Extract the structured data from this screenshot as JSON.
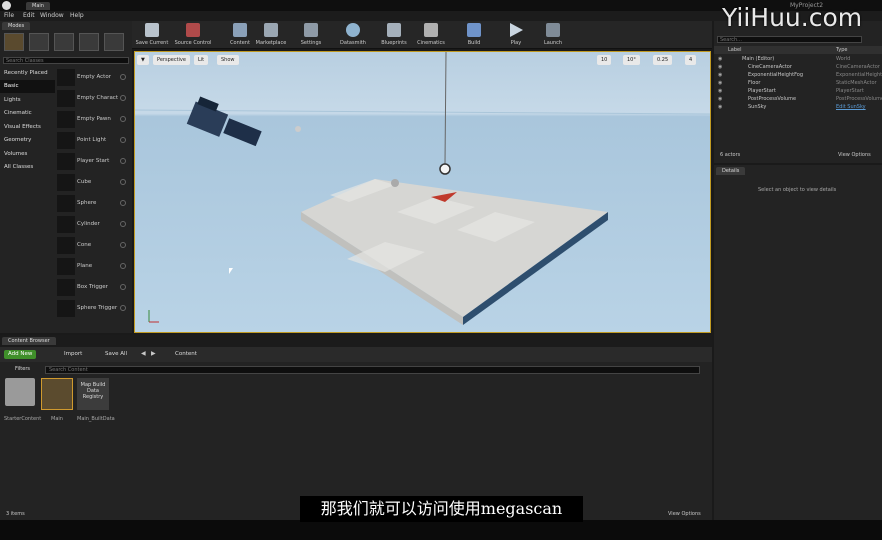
{
  "window": {
    "tab": "Main",
    "project": "MyProject2"
  },
  "menu": [
    "File",
    "Edit",
    "Window",
    "Help"
  ],
  "modes": {
    "title": "Modes",
    "search_placeholder": "Search Classes",
    "categories": [
      "Recently Placed",
      "Basic",
      "Lights",
      "Cinematic",
      "Visual Effects",
      "Geometry",
      "Volumes",
      "All Classes"
    ],
    "items": [
      "Empty Actor",
      "Empty Charact",
      "Empty Pawn",
      "Point Light",
      "Player Start",
      "Cube",
      "Sphere",
      "Cylinder",
      "Cone",
      "Plane",
      "Box Trigger",
      "Sphere Trigger"
    ]
  },
  "toolbar": [
    "Save Current",
    "Source Control",
    "Content",
    "Marketplace",
    "Settings",
    "Datasmith",
    "Blueprints",
    "Cinematics",
    "Build",
    "Play",
    "Launch"
  ],
  "viewport": {
    "view_mode": "Perspective",
    "lighting": "Lit",
    "show": "Show",
    "grid_snap": "10",
    "rot_snap": "10°",
    "scale_snap": "0.25",
    "camera_speed": "4"
  },
  "outliner": {
    "search_placeholder": "Search...",
    "col_label": "Label",
    "col_type": "Type",
    "rows": [
      {
        "label": "Main (Editor)",
        "type": "World"
      },
      {
        "label": "CineCameraActor",
        "type": "CineCameraActor"
      },
      {
        "label": "ExponentialHeightFog",
        "type": "ExponentialHeightFog"
      },
      {
        "label": "Floor",
        "type": "StaticMeshActor"
      },
      {
        "label": "PlayerStart",
        "type": "PlayerStart"
      },
      {
        "label": "PostProcessVolume",
        "type": "PostProcessVolume"
      },
      {
        "label": "SunSky",
        "type": "Edit SunSky"
      }
    ],
    "count": "6 actors",
    "view_options": "View Options"
  },
  "details": {
    "title": "Details",
    "empty_text": "Select an object to view details"
  },
  "content_browser": {
    "tab": "Content Browser",
    "add_new": "Add New",
    "import": "Import",
    "save_all": "Save All",
    "path": "Content",
    "filters": "Filters",
    "search_placeholder": "Search Content",
    "assets": [
      {
        "name": "StarterContent",
        "thumb": ""
      },
      {
        "name": "Main",
        "thumb": ""
      },
      {
        "name": "Main_BuiltData",
        "thumb": "Map Build Data Registry"
      }
    ],
    "item_count": "3 items",
    "view_options": "View Options"
  },
  "subtitle": "那我们就可以访问使用megascan",
  "watermark": "YiiHuu.com"
}
